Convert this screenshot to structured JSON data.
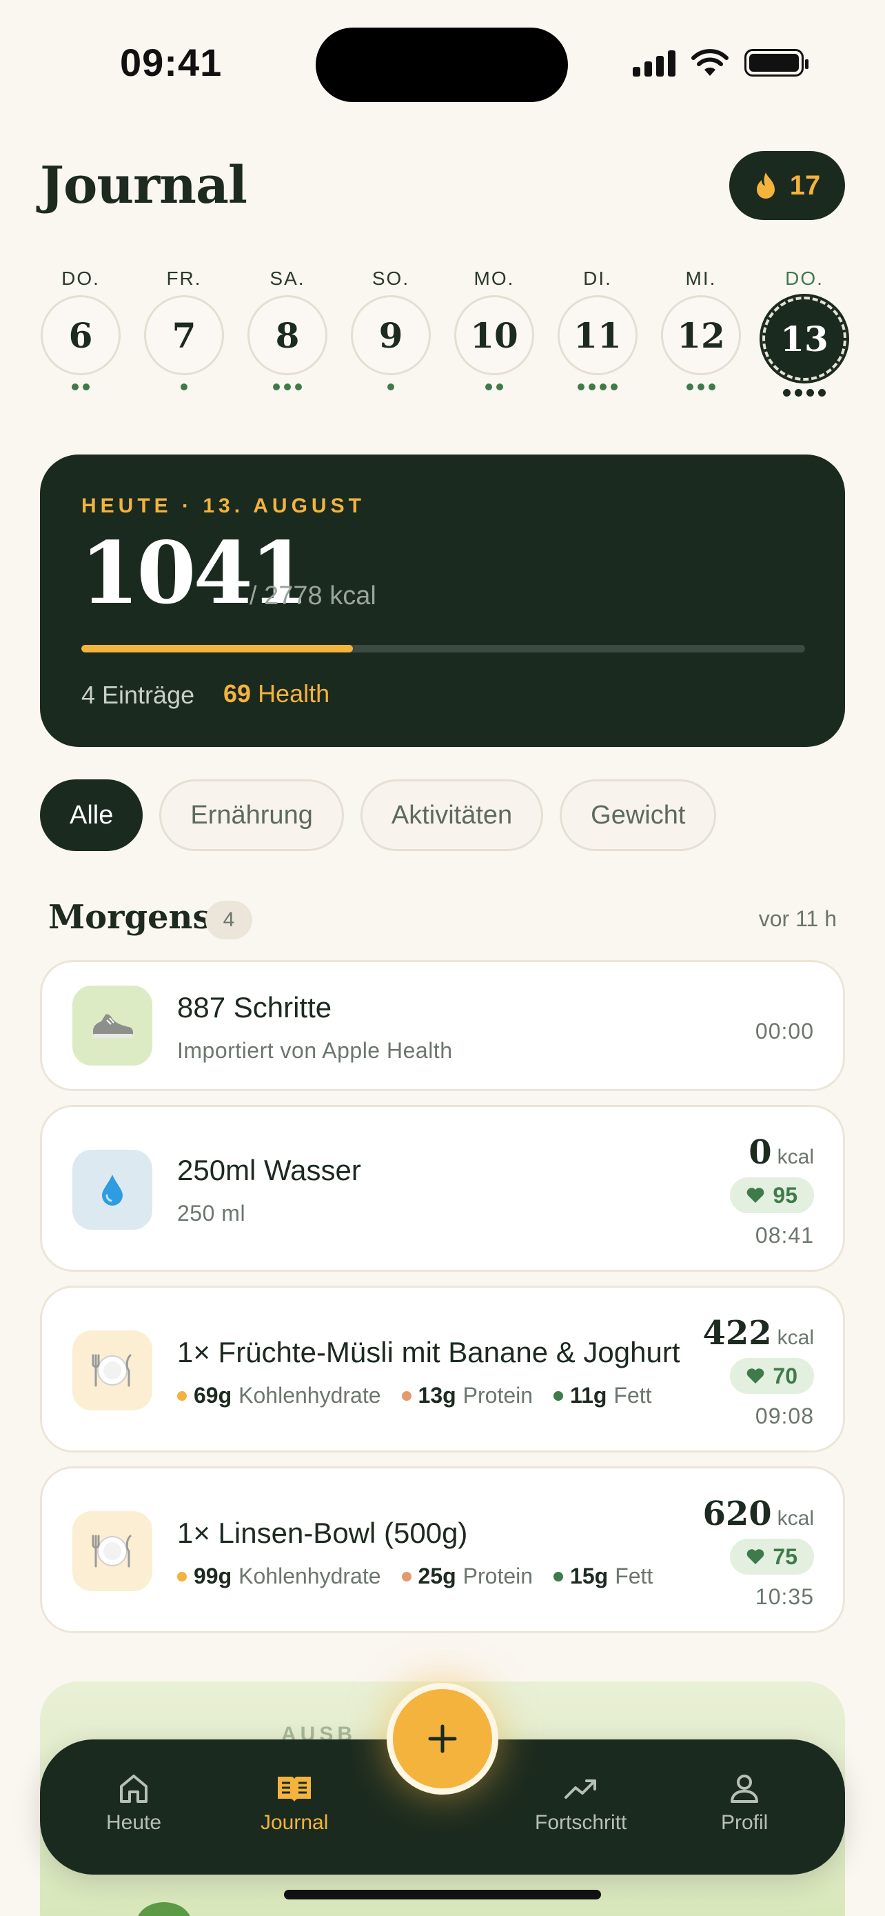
{
  "status_bar": {
    "time": "09:41"
  },
  "header": {
    "title": "Journal",
    "streak": "17",
    "streak_icon": "flame-icon"
  },
  "week": [
    {
      "label": "DO.",
      "day": "6",
      "dots": 2,
      "active": false
    },
    {
      "label": "FR.",
      "day": "7",
      "dots": 1,
      "active": false
    },
    {
      "label": "SA.",
      "day": "8",
      "dots": 3,
      "active": false
    },
    {
      "label": "SO.",
      "day": "9",
      "dots": 1,
      "active": false
    },
    {
      "label": "MO.",
      "day": "10",
      "dots": 2,
      "active": false
    },
    {
      "label": "DI.",
      "day": "11",
      "dots": 4,
      "active": false
    },
    {
      "label": "MI.",
      "day": "12",
      "dots": 3,
      "active": false
    },
    {
      "label": "DO.",
      "day": "13",
      "dots": 4,
      "active": true
    }
  ],
  "summary": {
    "date_label": "HEUTE · 13. AUGUST",
    "kcal": "1041",
    "goal": "/ 2778 kcal",
    "progress_fraction": 0.375,
    "entries": "4 Einträge",
    "health_value": "69",
    "health_label": "Health"
  },
  "filters": [
    "Alle",
    "Ernährung",
    "Aktivitäten",
    "Gewicht"
  ],
  "section": {
    "title": "Morgens",
    "count": "4",
    "time": "vor 11 h"
  },
  "entries": [
    {
      "icon": "sneaker-icon",
      "title": "887 Schritte",
      "subtitle": "Importiert von Apple Health",
      "time": "00:00"
    },
    {
      "icon": "water-drop-icon",
      "title": "250ml Wasser",
      "subtitle": "250 ml",
      "kcal": "0",
      "kcal_unit": "kcal",
      "health": "95",
      "time": "08:41"
    },
    {
      "icon": "plate-icon",
      "title": "1× Früchte-Müsli mit Banane & Joghurt",
      "macros": [
        {
          "value": "69g",
          "label": "Kohlenhydrate"
        },
        {
          "value": "13g",
          "label": "Protein"
        },
        {
          "value": "11g",
          "label": "Fett"
        }
      ],
      "kcal": "422",
      "kcal_unit": "kcal",
      "health": "70",
      "time": "09:08"
    },
    {
      "icon": "plate-icon",
      "title": "1× Linsen-Bowl (500g)",
      "macros": [
        {
          "value": "99g",
          "label": "Kohlenhydrate"
        },
        {
          "value": "25g",
          "label": "Protein"
        },
        {
          "value": "15g",
          "label": "Fett"
        }
      ],
      "kcal": "620",
      "kcal_unit": "kcal",
      "health": "75",
      "time": "10:35"
    }
  ],
  "promo": {
    "label": "AUSB"
  },
  "nav": [
    {
      "label": "Heute",
      "icon": "home-icon"
    },
    {
      "label": "Journal",
      "icon": "book-icon",
      "active": true
    },
    {
      "label": "Fortschritt",
      "icon": "trend-icon"
    },
    {
      "label": "Profil",
      "icon": "person-icon"
    }
  ],
  "colors": {
    "background": "#faf6f0",
    "dark": "#1b2a1f",
    "accent": "#f3b33d",
    "green": "#3f7a4b",
    "carb_dot": "#f3b33d",
    "protein_dot": "#e49a6e",
    "fat_dot": "#3f7a4b"
  }
}
